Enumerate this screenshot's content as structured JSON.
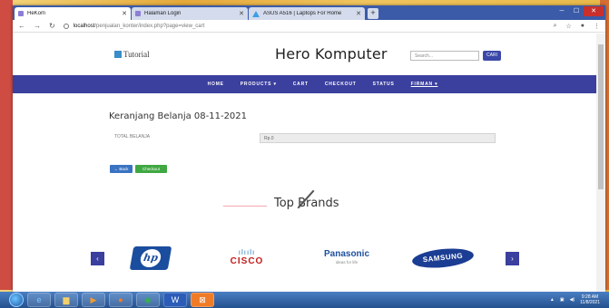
{
  "browser": {
    "tabs": [
      {
        "title": "HeKom",
        "active": true
      },
      {
        "title": "Halaman Login",
        "active": false
      },
      {
        "title": "ASUS A516 | Laptops For Home",
        "active": false
      }
    ],
    "new_tab": "+",
    "url_host": "localhost",
    "url_path": "/penjualan_konter/index.php?page=view_cart"
  },
  "site": {
    "logo_text": "Tutorial",
    "title": "Hero Komputer",
    "search_placeholder": "Search...",
    "search_button": "CARI",
    "menu": [
      "HOME",
      "PRODUCTS ▾",
      "CART",
      "CHECKOUT",
      "STATUS",
      "FIRMAN ▾"
    ]
  },
  "cart": {
    "title": "Keranjang Belanja 08-11-2021",
    "total_label": "TOTAL BELANJA",
    "total_value": "Rp.0",
    "back_button": "← Back",
    "checkout_button": "Checkout"
  },
  "brands": {
    "heading": "Top Brands",
    "prev": "‹",
    "next": "›",
    "hp": "hp",
    "cisco_bars": "ılıılı",
    "cisco": "CISCO",
    "panasonic": "Panasonic",
    "panasonic_tag": "ideas for life",
    "samsung": "SAMSUNG"
  },
  "taskbar": {
    "time": "9:28 AM",
    "date": "11/8/2021"
  },
  "colors": {
    "navbar": "#3b3f9e",
    "back_button": "#3a73c2",
    "checkout_button": "#40a843"
  }
}
